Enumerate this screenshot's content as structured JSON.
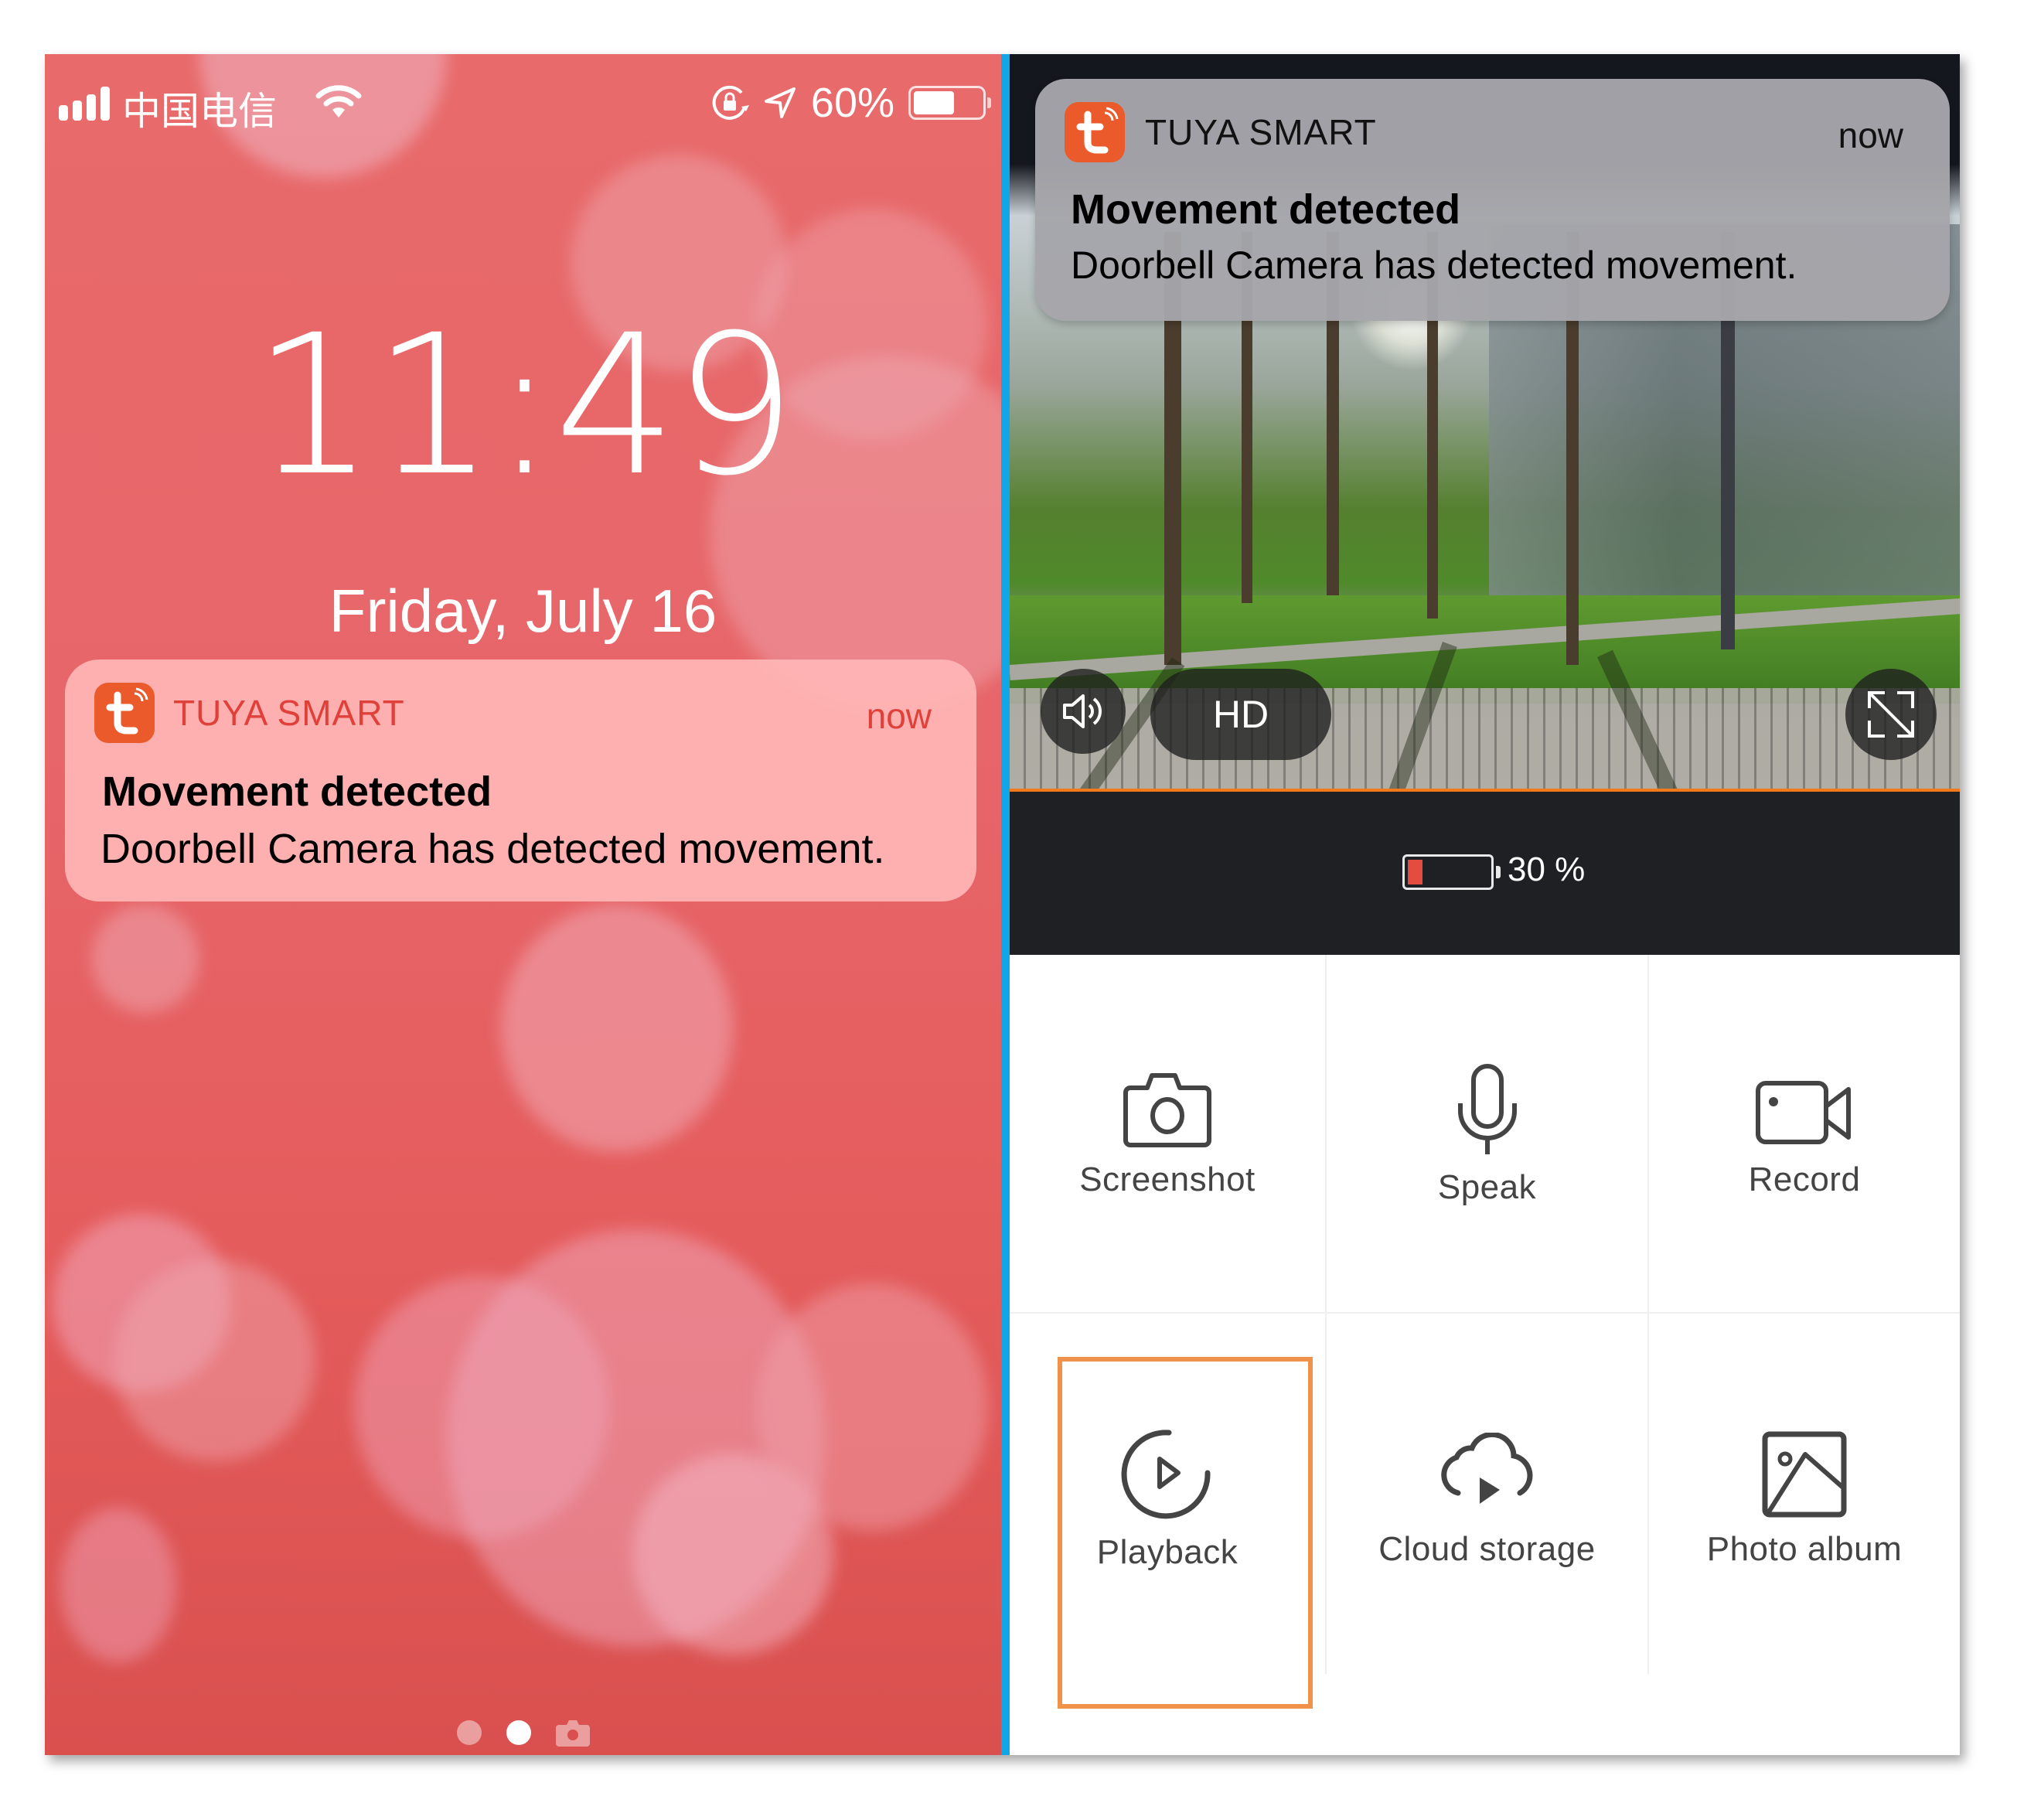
{
  "lock_screen": {
    "status_bar": {
      "carrier": "中国电信",
      "battery_percent_label": "60%",
      "battery_level": 0.6,
      "icons": [
        "signal-icon",
        "wifi-icon",
        "rotation-lock-icon",
        "location-icon",
        "battery-icon"
      ]
    },
    "time": "11:49",
    "date": "Friday, July 16",
    "notification": {
      "app_name": "TUYA SMART",
      "time": "now",
      "title": "Movement detected",
      "body": "Doorbell Camera has detected movement."
    },
    "pager": {
      "pages": 2,
      "active_page": 2,
      "camera_shortcut": "camera-icon"
    }
  },
  "camera_app": {
    "notification": {
      "app_name": "TUYA SMART",
      "time": "now",
      "title": "Movement detected",
      "body": "Doorbell Camera has detected movement."
    },
    "video_controls": {
      "quality_label": "HD",
      "mute_icon": "speaker-icon",
      "fullscreen_icon": "fullscreen-icon"
    },
    "device_battery": {
      "label": "30 %",
      "level": 0.3
    },
    "actions": [
      {
        "label": "Screenshot",
        "icon": "camera-icon"
      },
      {
        "label": "Speak",
        "icon": "microphone-icon"
      },
      {
        "label": "Record",
        "icon": "video-camera-icon"
      },
      {
        "label": "Playback",
        "icon": "playback-icon",
        "highlighted": true
      },
      {
        "label": "Cloud storage",
        "icon": "cloud-play-icon"
      },
      {
        "label": "Photo album",
        "icon": "photo-icon"
      }
    ]
  },
  "colors": {
    "lock_bg": "#e56462",
    "divider": "#11a6e8",
    "tuya_orange": "#ea5a2a",
    "app_name_red": "#e0403a",
    "highlight_orange": "#f0924a",
    "battery_low": "#e34c3f"
  }
}
